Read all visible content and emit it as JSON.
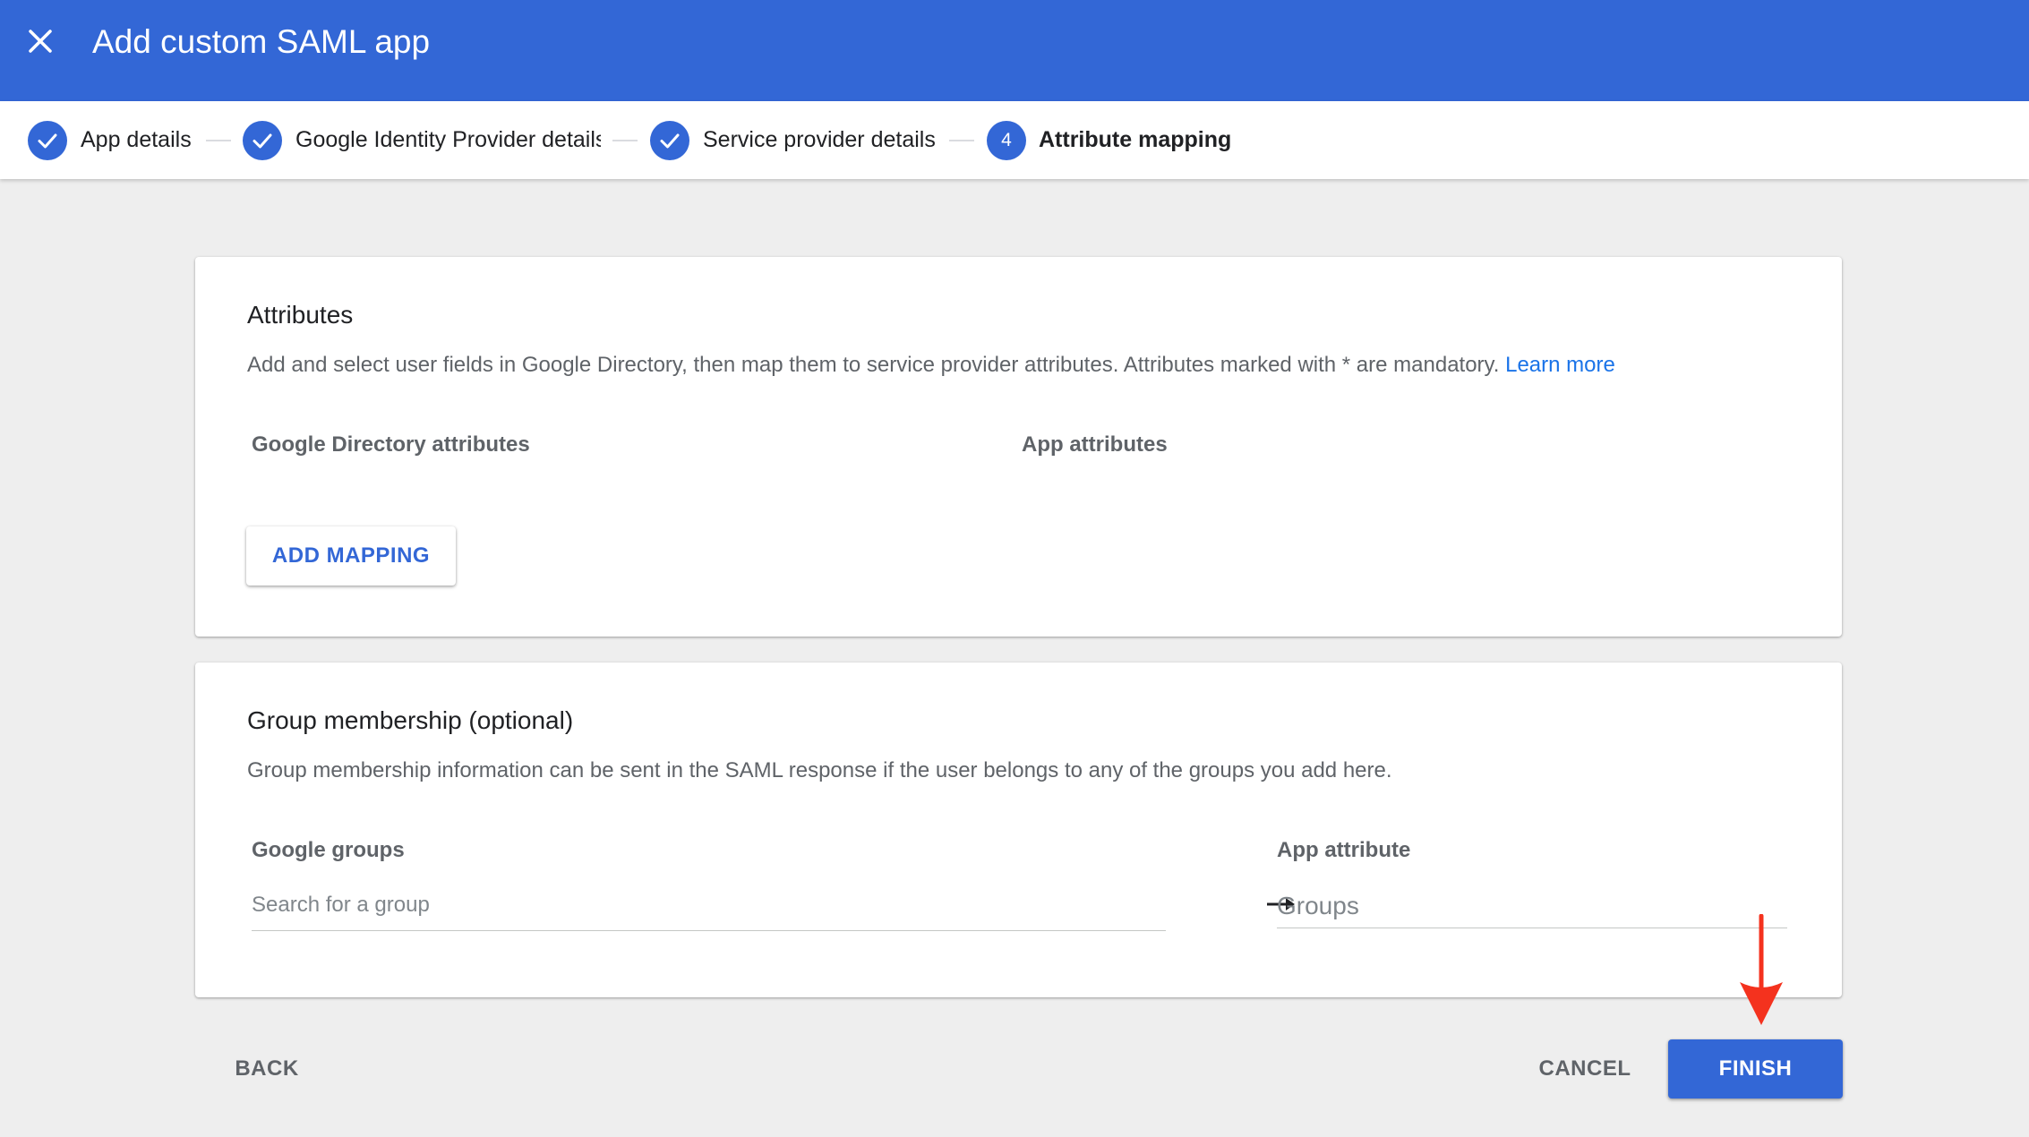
{
  "header": {
    "title": "Add custom SAML app",
    "close_icon": "close-icon",
    "background_color": "#3367d6"
  },
  "stepper": {
    "steps": [
      {
        "label": "App details",
        "state": "completed",
        "icon": "check-icon"
      },
      {
        "label": "Google Identity Provider details",
        "state": "completed",
        "icon": "check-icon"
      },
      {
        "label": "Service provider details",
        "state": "completed",
        "icon": "check-icon"
      },
      {
        "label": "Attribute mapping",
        "state": "active",
        "number": "4"
      }
    ]
  },
  "attributes_card": {
    "title": "Attributes",
    "description": "Add and select user fields in Google Directory, then map them to service provider attributes. Attributes marked with * are mandatory.",
    "learn_more": "Learn more",
    "col_directory": "Google Directory attributes",
    "col_app": "App attributes",
    "add_mapping_label": "ADD MAPPING"
  },
  "group_card": {
    "title": "Group membership (optional)",
    "description": "Group membership information can be sent in the SAML response if the user belongs to any of the groups you add here.",
    "col_groups": "Google groups",
    "groups_placeholder": "Search for a group",
    "col_app_attribute": "App attribute",
    "app_attribute_placeholder": "Groups",
    "arrow_icon": "arrow-right-icon"
  },
  "footer": {
    "back_label": "BACK",
    "cancel_label": "CANCEL",
    "finish_label": "FINISH"
  },
  "colors": {
    "accent": "#3367d6",
    "link": "#1a73e8",
    "annotation": "#f4321e"
  }
}
